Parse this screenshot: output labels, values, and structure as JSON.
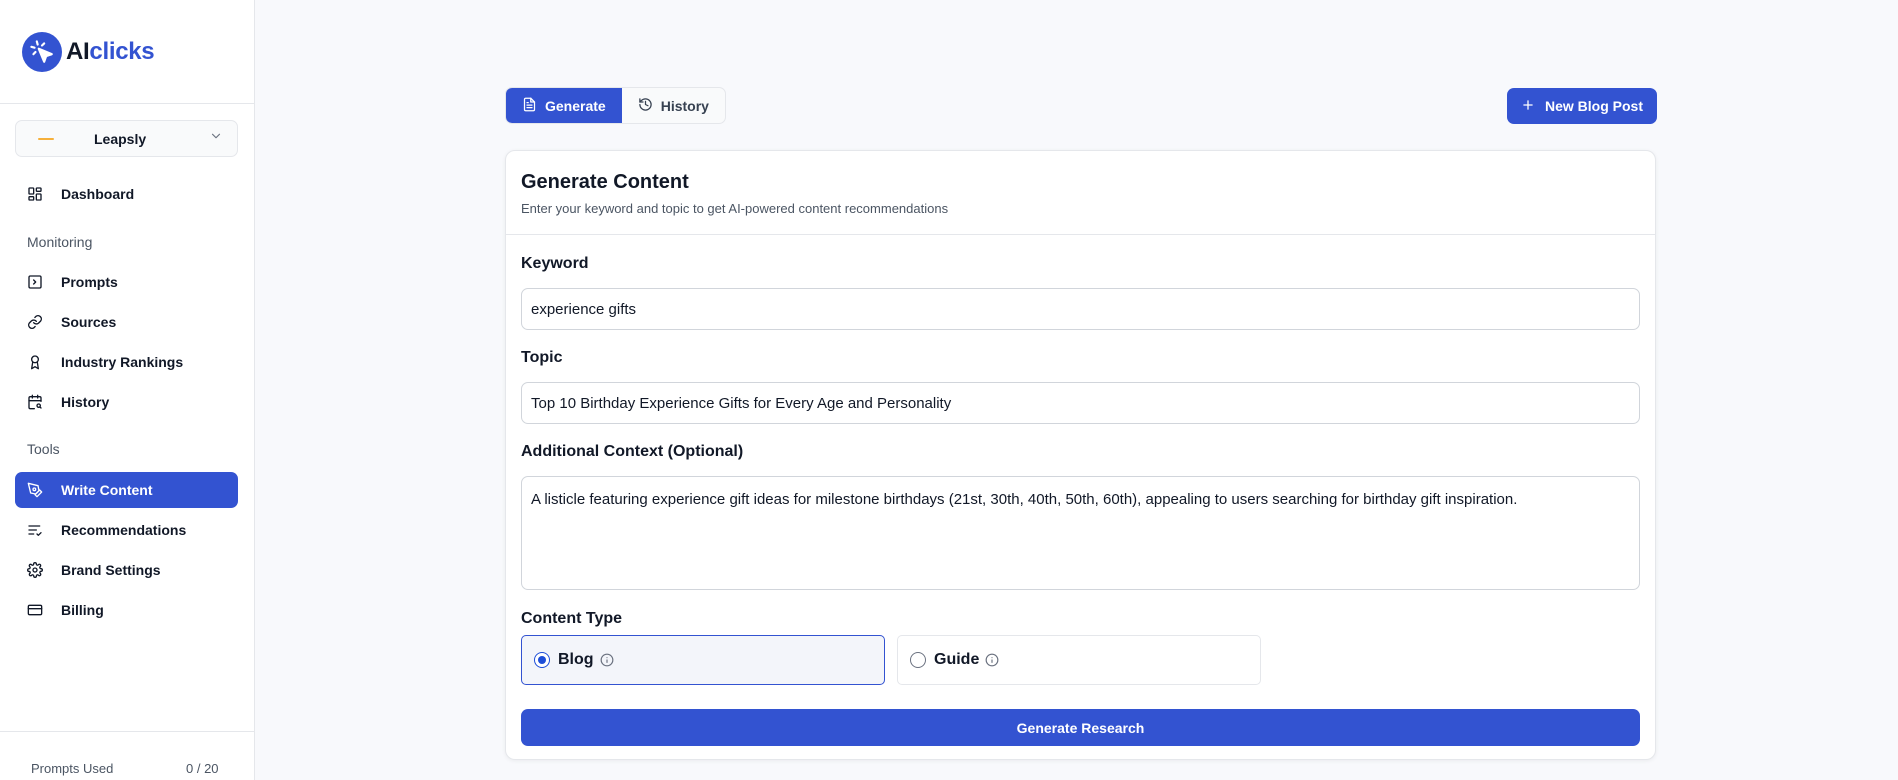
{
  "brand": {
    "logo_ai": "AI",
    "logo_clicks": "clicks",
    "accent": "#3353d1"
  },
  "workspace": {
    "name": "Leapsly",
    "logo_icon": "leapsly-logo"
  },
  "sidebar": {
    "items": [
      {
        "label": "Dashboard",
        "icon": "grid-icon"
      },
      {
        "label": "Prompts",
        "icon": "terminal-icon"
      },
      {
        "label": "Sources",
        "icon": "link-icon"
      },
      {
        "label": "Industry Rankings",
        "icon": "award-icon"
      },
      {
        "label": "History",
        "icon": "calendar-search-icon"
      },
      {
        "label": "Write Content",
        "icon": "pen-tool-icon"
      },
      {
        "label": "Recommendations",
        "icon": "list-check-icon"
      },
      {
        "label": "Brand Settings",
        "icon": "gear-icon"
      },
      {
        "label": "Billing",
        "icon": "credit-card-icon"
      }
    ],
    "sections": {
      "monitoring": "Monitoring",
      "tools": "Tools"
    },
    "active": "Write Content",
    "usage": {
      "label": "Prompts Used",
      "count": "0 / 20"
    }
  },
  "tabs": [
    {
      "label": "Generate",
      "icon": "file-text-icon",
      "active": true
    },
    {
      "label": "History",
      "icon": "history-icon",
      "active": false
    }
  ],
  "new_post_button": {
    "label": "New Blog Post",
    "icon": "plus-icon"
  },
  "form": {
    "title": "Generate Content",
    "subtitle": "Enter your keyword and topic to get AI-powered content recommendations",
    "keyword": {
      "label": "Keyword",
      "value": "experience gifts"
    },
    "topic": {
      "label": "Topic",
      "value": "Top 10 Birthday Experience Gifts for Every Age and Personality"
    },
    "context": {
      "label": "Additional Context (Optional)",
      "value": "A listicle featuring experience gift ideas for milestone birthdays (21st, 30th, 40th, 50th, 60th), appealing to users searching for birthday gift inspiration."
    },
    "content_type": {
      "label": "Content Type",
      "options": [
        {
          "label": "Blog",
          "selected": true,
          "icon": "info-icon"
        },
        {
          "label": "Guide",
          "selected": false,
          "icon": "info-icon"
        }
      ]
    },
    "submit_label": "Generate Research"
  }
}
